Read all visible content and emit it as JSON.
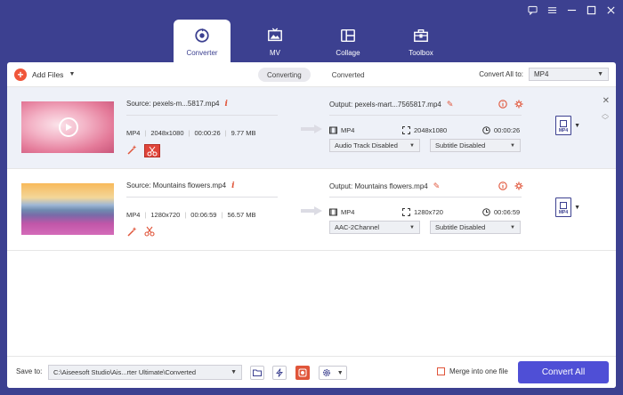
{
  "main_tabs": [
    {
      "label": "Converter",
      "icon": "converter-icon",
      "active": true
    },
    {
      "label": "MV",
      "icon": "mv-icon",
      "active": false
    },
    {
      "label": "Collage",
      "icon": "collage-icon",
      "active": false
    },
    {
      "label": "Toolbox",
      "icon": "toolbox-icon",
      "active": false
    }
  ],
  "toolbar": {
    "add_files": "Add Files",
    "sub_tabs": [
      "Converting",
      "Converted"
    ],
    "convert_all_to_label": "Convert All to:",
    "convert_all_to_value": "MP4"
  },
  "files": [
    {
      "source": "Source: pexels-m...5817.mp4",
      "format": "MP4",
      "resolution": "2048x1080",
      "duration": "00:00:26",
      "size": "9.77 MB",
      "output": "Output: pexels-mart...7565817.mp4",
      "out_format": "MP4",
      "out_resolution": "2048x1080",
      "out_duration": "00:00:26",
      "audio": "Audio Track Disabled",
      "subtitle": "Subtitle Disabled",
      "format_tile": "MP4"
    },
    {
      "source": "Source: Mountains flowers.mp4",
      "format": "MP4",
      "resolution": "1280x720",
      "duration": "00:06:59",
      "size": "56.57 MB",
      "output": "Output: Mountains flowers.mp4",
      "out_format": "MP4",
      "out_resolution": "1280x720",
      "out_duration": "00:06:59",
      "audio": "AAC-2Channel",
      "subtitle": "Subtitle Disabled",
      "format_tile": "MP4"
    }
  ],
  "bottom": {
    "save_to_label": "Save to:",
    "save_path": "C:\\Aiseesoft Studio\\Ais...rter Ultimate\\Converted",
    "merge_label": "Merge into one file",
    "convert_all": "Convert All"
  },
  "colors": {
    "brand": "#3c4090",
    "accent": "#f0563a",
    "button": "#4f4fd6"
  }
}
